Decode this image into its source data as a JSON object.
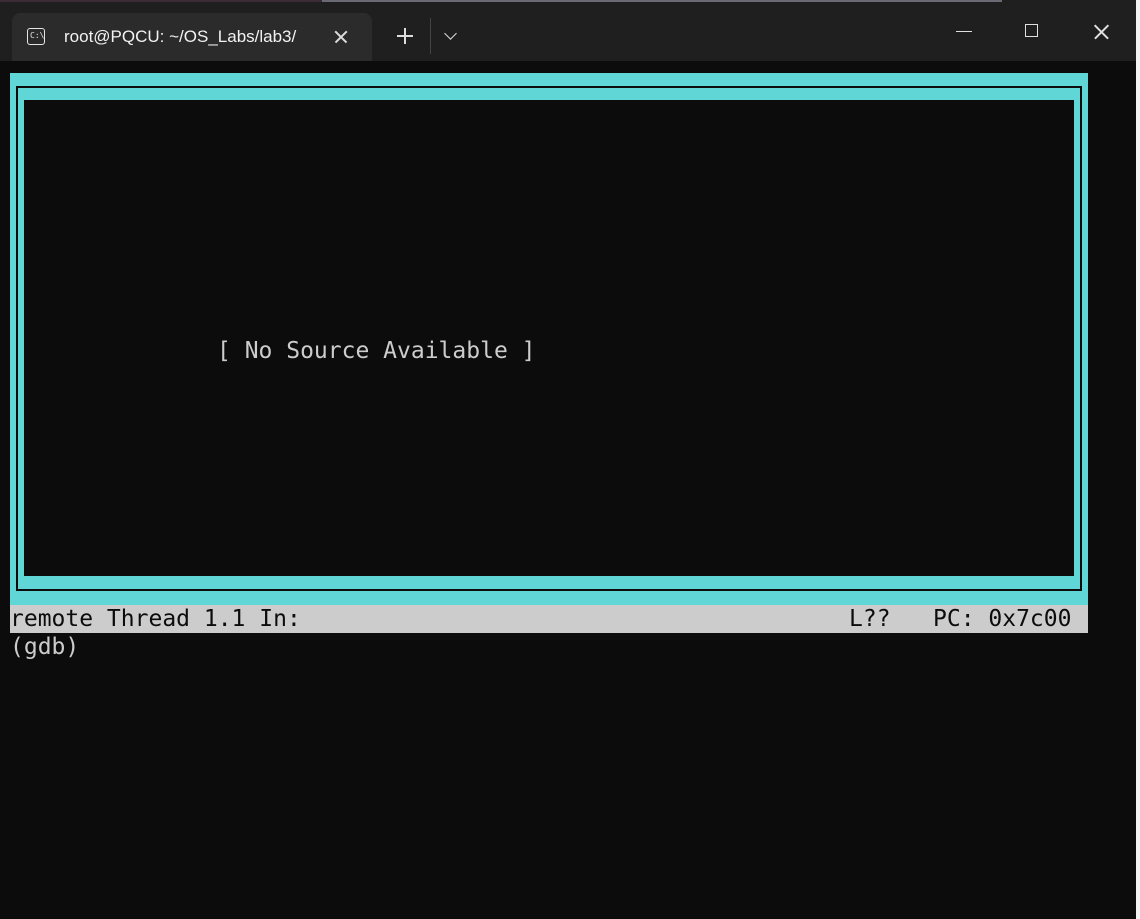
{
  "window": {
    "tab_title": "root@PQCU: ~/OS_Labs/lab3/",
    "tab_icon_text": "C:\\"
  },
  "colors": {
    "frame": "#61d6d6",
    "terminal_bg": "#0c0c0c",
    "status_bg": "#cccccc",
    "text": "#cccccc"
  },
  "tui": {
    "source_message": "[ No Source Available ]",
    "status": {
      "left": "remote Thread 1.1 In:",
      "line": "L??",
      "pc": "PC: 0x7c00"
    },
    "prompt": "(gdb)"
  }
}
